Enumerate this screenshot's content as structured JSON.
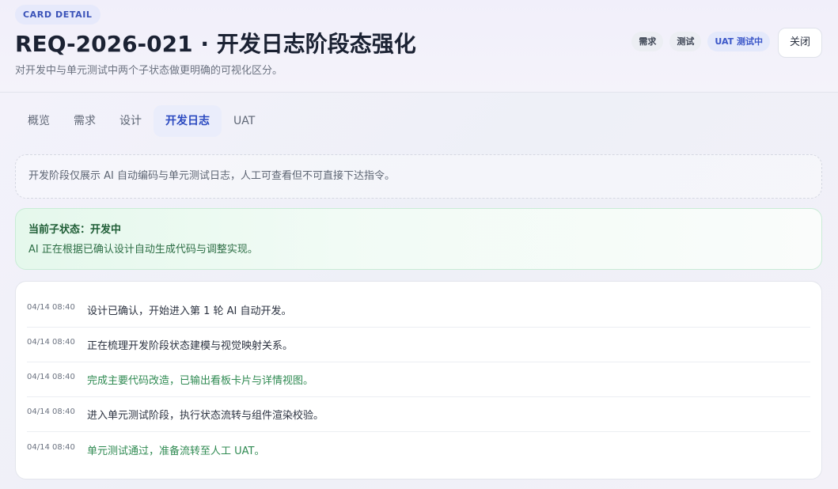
{
  "header": {
    "eyebrow": "CARD DETAIL",
    "title": "REQ-2026-021 · 开发日志阶段态强化",
    "subtitle": "对开发中与单元测试中两个子状态做更明确的可视化区分。",
    "stage_chips": [
      {
        "label": "需求",
        "active": false
      },
      {
        "label": "测试",
        "active": false
      },
      {
        "label": "UAT 测试中",
        "active": true
      }
    ],
    "close_label": "关闭"
  },
  "tabs": [
    {
      "label": "概览",
      "active": false
    },
    {
      "label": "需求",
      "active": false
    },
    {
      "label": "设计",
      "active": false
    },
    {
      "label": "开发日志",
      "active": true
    },
    {
      "label": "UAT",
      "active": false
    }
  ],
  "notice": "开发阶段仅展示 AI 自动编码与单元测试日志，人工可查看但不可直接下达指令。",
  "status": {
    "title": "当前子状态：开发中",
    "description": "AI 正在根据已确认设计自动生成代码与调整实现。"
  },
  "logs": [
    {
      "time": "04/14 08:40",
      "message": "设计已确认，开始进入第 1 轮 AI 自动开发。",
      "success": false
    },
    {
      "time": "04/14 08:40",
      "message": "正在梳理开发阶段状态建模与视觉映射关系。",
      "success": false
    },
    {
      "time": "04/14 08:40",
      "message": "完成主要代码改造，已输出看板卡片与详情视图。",
      "success": true
    },
    {
      "time": "04/14 08:40",
      "message": "进入单元测试阶段，执行状态流转与组件渲染校验。",
      "success": false
    },
    {
      "time": "04/14 08:40",
      "message": "单元测试通过，准备流转至人工 UAT。",
      "success": true
    }
  ],
  "colors": {
    "accent": "#2a49c0",
    "success": "#2f8a52",
    "status_bg": "#e5f8ec"
  }
}
